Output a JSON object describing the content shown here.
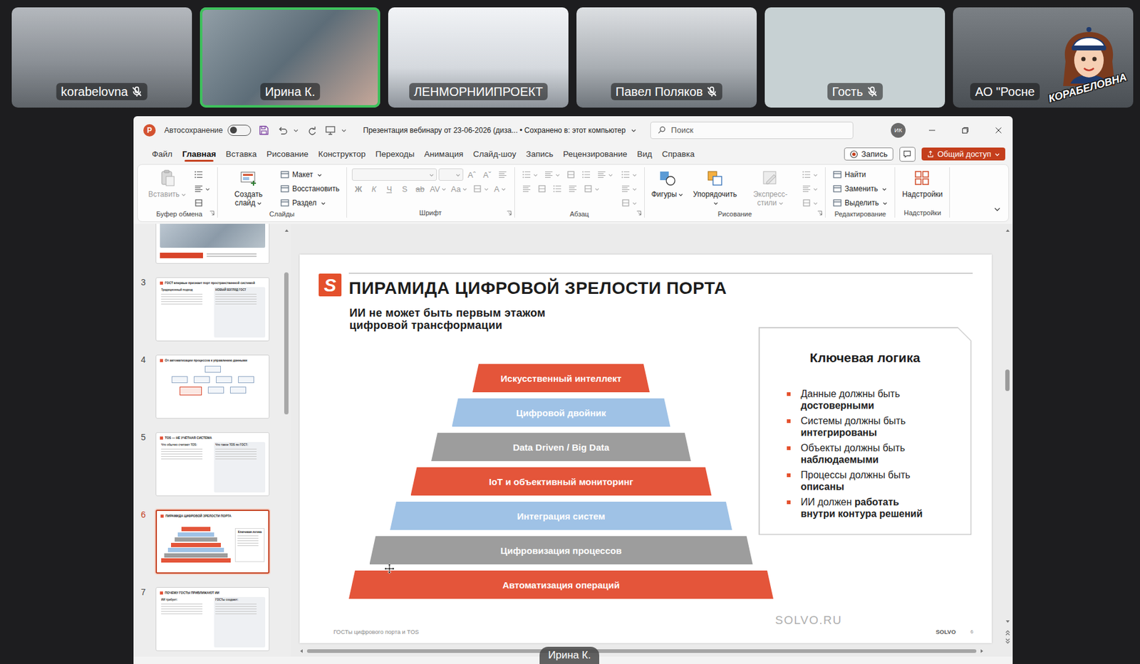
{
  "meeting": {
    "participants": [
      {
        "name": "korabelovna",
        "muted": true,
        "speaking": false,
        "kind": "camera"
      },
      {
        "name": "Ирина К.",
        "muted": false,
        "speaking": true,
        "kind": "camera"
      },
      {
        "name": "ЛЕНМОРНИИПРОЕКТ",
        "muted": false,
        "speaking": false,
        "kind": "camera"
      },
      {
        "name": "Павел Поляков",
        "muted": true,
        "speaking": false,
        "kind": "camera"
      },
      {
        "name": "Гость",
        "muted": true,
        "speaking": false,
        "kind": "blank"
      },
      {
        "name": "АО \"Росне",
        "muted": false,
        "speaking": false,
        "kind": "camera"
      }
    ],
    "speaker_caption": "Ирина К.",
    "sticker": "КОРАБЕЛОВНА"
  },
  "app": {
    "logo": "P",
    "autosave_label": "Автосохранение",
    "autosave_on": false,
    "doc_title": "Презентация вебинару от 23-06-2026 (диза... • Сохранено в: этот компьютер",
    "search_placeholder": "Поиск",
    "avatar": "ИК",
    "tabs": [
      {
        "label": "Файл",
        "selected": false
      },
      {
        "label": "Главная",
        "selected": true
      },
      {
        "label": "Вставка",
        "selected": false
      },
      {
        "label": "Рисование",
        "selected": false
      },
      {
        "label": "Конструктор",
        "selected": false
      },
      {
        "label": "Переходы",
        "selected": false
      },
      {
        "label": "Анимация",
        "selected": false
      },
      {
        "label": "Слайд-шоу",
        "selected": false
      },
      {
        "label": "Запись",
        "selected": false
      },
      {
        "label": "Рецензирование",
        "selected": false
      },
      {
        "label": "Вид",
        "selected": false
      },
      {
        "label": "Справка",
        "selected": false
      }
    ],
    "record_button": "Запись",
    "share_button": "Общий доступ"
  },
  "ribbon": [
    {
      "label": "Буфер обмена",
      "launcher": true,
      "blocks": [
        {
          "kind": "big",
          "label": "Вставить",
          "disabled": true,
          "menu": true
        },
        {
          "kind": "stack",
          "rows": [
            [
              {
                "kind": "icon",
                "disabled": false,
                "menu": false
              }
            ],
            [
              {
                "kind": "icon",
                "disabled": false,
                "menu": true
              }
            ],
            [
              {
                "kind": "icon",
                "disabled": false,
                "menu": false
              }
            ]
          ]
        }
      ]
    },
    {
      "label": "Слайды",
      "launcher": false,
      "blocks": [
        {
          "kind": "big",
          "label": "Создать слайд",
          "disabled": false,
          "menu": true
        },
        {
          "kind": "stack",
          "rows": [
            [
              {
                "kind": "small",
                "label": "Макет",
                "disabled": false,
                "menu": true
              }
            ],
            [
              {
                "kind": "small",
                "label": "Восстановить",
                "disabled": false,
                "menu": false
              }
            ],
            [
              {
                "kind": "small",
                "label": "Раздел",
                "disabled": false,
                "menu": true
              }
            ]
          ]
        }
      ]
    },
    {
      "label": "Шрифт",
      "launcher": true,
      "blocks": [
        {
          "kind": "stack",
          "rows": [
            [
              {
                "kind": "fontfield",
                "disabled": true,
                "menu": true
              },
              {
                "kind": "sizefield",
                "disabled": true,
                "menu": true
              },
              {
                "kind": "glyph",
                "label": "Aˆ",
                "disabled": true,
                "menu": false
              },
              {
                "kind": "glyph",
                "label": "Aˇ",
                "disabled": true,
                "menu": false
              },
              {
                "kind": "icon",
                "disabled": true,
                "menu": false
              }
            ],
            [
              {
                "kind": "bold",
                "label": "Ж",
                "disabled": true,
                "menu": false
              },
              {
                "kind": "italic",
                "label": "К",
                "disabled": true,
                "menu": false
              },
              {
                "kind": "underline",
                "label": "Ч",
                "disabled": true,
                "menu": false
              },
              {
                "kind": "glyph",
                "label": "S",
                "disabled": true,
                "menu": false
              },
              {
                "kind": "strike",
                "label": "ab",
                "disabled": true,
                "menu": false
              },
              {
                "kind": "glyph",
                "label": "AV",
                "disabled": true,
                "menu": true
              },
              {
                "kind": "glyph",
                "label": "Aa",
                "disabled": true,
                "menu": true
              },
              {
                "kind": "icon",
                "disabled": true,
                "menu": true
              },
              {
                "kind": "glyph",
                "label": "A",
                "disabled": true,
                "menu": true
              }
            ]
          ]
        }
      ]
    },
    {
      "label": "Абзац",
      "launcher": true,
      "blocks": [
        {
          "kind": "stack",
          "rows": [
            [
              {
                "kind": "icon",
                "disabled": true,
                "menu": true
              },
              {
                "kind": "icon",
                "disabled": true,
                "menu": true
              },
              {
                "kind": "icon",
                "disabled": true,
                "menu": false
              },
              {
                "kind": "icon",
                "disabled": true,
                "menu": false
              },
              {
                "kind": "icon",
                "disabled": true,
                "menu": true
              }
            ],
            [
              {
                "kind": "icon",
                "disabled": true,
                "menu": false
              },
              {
                "kind": "icon",
                "disabled": true,
                "menu": false
              },
              {
                "kind": "icon",
                "disabled": true,
                "menu": false
              },
              {
                "kind": "icon",
                "disabled": true,
                "menu": false
              },
              {
                "kind": "icon",
                "disabled": true,
                "menu": true
              }
            ]
          ]
        },
        {
          "kind": "stack",
          "rows": [
            [
              {
                "kind": "icon",
                "disabled": true,
                "menu": true
              }
            ],
            [
              {
                "kind": "icon",
                "disabled": true,
                "menu": true
              }
            ],
            [
              {
                "kind": "icon",
                "disabled": true,
                "menu": true
              }
            ]
          ]
        }
      ]
    },
    {
      "label": "Рисование",
      "launcher": true,
      "blocks": [
        {
          "kind": "big",
          "label": "Фигуры",
          "disabled": false,
          "menu": true
        },
        {
          "kind": "big",
          "label": "Упорядочить",
          "disabled": false,
          "menu": true
        },
        {
          "kind": "big",
          "label": "Экспресс-стили",
          "disabled": true,
          "menu": true
        },
        {
          "kind": "stack",
          "rows": [
            [
              {
                "kind": "icon",
                "disabled": true,
                "menu": true
              }
            ],
            [
              {
                "kind": "icon",
                "disabled": true,
                "menu": true
              }
            ],
            [
              {
                "kind": "icon",
                "disabled": true,
                "menu": true
              }
            ]
          ]
        }
      ]
    },
    {
      "label": "Редактирование",
      "launcher": false,
      "blocks": [
        {
          "kind": "stack",
          "rows": [
            [
              {
                "kind": "small",
                "label": "Найти",
                "disabled": false,
                "menu": false
              }
            ],
            [
              {
                "kind": "small",
                "label": "Заменить",
                "disabled": false,
                "menu": true
              }
            ],
            [
              {
                "kind": "small",
                "label": "Выделить",
                "disabled": false,
                "menu": true
              }
            ]
          ]
        }
      ]
    },
    {
      "label": "Надстройки",
      "launcher": false,
      "blocks": [
        {
          "kind": "big",
          "label": "Надстройки",
          "disabled": false,
          "menu": false
        }
      ]
    }
  ],
  "thumbnails": [
    {
      "selected": false,
      "kind": "photo"
    },
    {
      "number": "3",
      "selected": false,
      "kind": "compare",
      "title": "ГОСТ впервые признает порт пространственной системой",
      "headings": [
        "Традиционный подход",
        "НОВЫЙ ВЗГЛЯД ГОСТ"
      ]
    },
    {
      "number": "4",
      "selected": false,
      "kind": "flow",
      "title": "От автоматизации процессов к управлению данными",
      "headings": []
    },
    {
      "number": "5",
      "selected": false,
      "kind": "compare",
      "title": "TOS — НЕ УЧЁТНАЯ СИСТЕМА",
      "headings": [
        "Что обычно считают TOS:",
        "Что такое TOS по ГОСТ:"
      ]
    },
    {
      "number": "6",
      "selected": true,
      "kind": "current"
    },
    {
      "number": "7",
      "selected": false,
      "kind": "compare",
      "title": "ПОЧЕМУ ГОСТЫ ПРИБЛИЖАЮТ ИИ",
      "headings": [
        "ИИ требует:",
        "ГОСТы создают:"
      ]
    }
  ],
  "slide": {
    "logo_mark": "S",
    "title": "ПИРАМИДА ЦИФРОВОЙ ЗРЕЛОСТИ ПОРТА",
    "subtitle": [
      "ИИ не может быть первым этажом",
      "цифровой трансформации"
    ],
    "pyramid": [
      {
        "label": "Искусственный интеллект",
        "color": "#e4553a"
      },
      {
        "label": "Цифровой двойник",
        "color": "#9fc2e6"
      },
      {
        "label": "Data Driven / Big Data",
        "color": "#9d9d9d"
      },
      {
        "label": "IoT и объективный мониторинг",
        "color": "#e4553a"
      },
      {
        "label": "Интеграция систем",
        "color": "#9fc2e6"
      },
      {
        "label": "Цифровизация процессов",
        "color": "#9d9d9d"
      },
      {
        "label": "Автоматизация операций",
        "color": "#e4553a"
      }
    ],
    "logic": {
      "title": "Ключевая логика",
      "items": [
        {
          "text": "Данные должны быть",
          "emphasis": "достоверными"
        },
        {
          "text": "Системы должны быть",
          "emphasis": "интегрированы"
        },
        {
          "text": "Объекты должны быть",
          "emphasis": "наблюдаемыми"
        },
        {
          "text": "Процессы должны быть",
          "emphasis": "описаны"
        },
        {
          "text": "ИИ должен",
          "emphasis": "работать внутри контура решений"
        }
      ]
    },
    "site": "SOLVO.RU",
    "footer": "ГОСТы цифрового порта и TOS",
    "brand": "SOLVO",
    "page": "6"
  }
}
